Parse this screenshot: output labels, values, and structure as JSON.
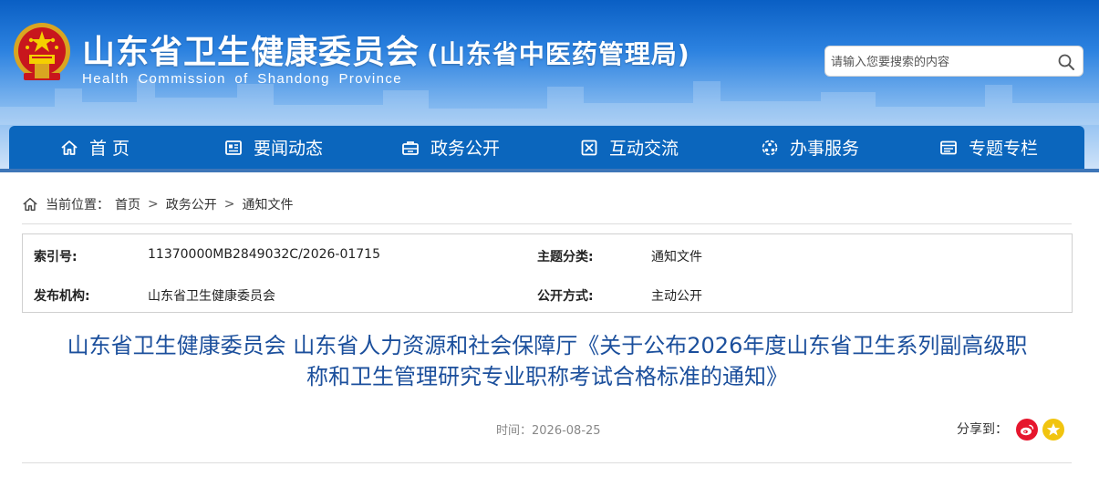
{
  "header": {
    "title": "山东省卫生健康委员会",
    "subtitle": "(山东省中医药管理局)",
    "english_name": "Health Commission of Shandong Province",
    "search_placeholder": "请输入您要搜索的内容"
  },
  "nav": {
    "items": [
      {
        "label": "首 页",
        "icon": "home-icon"
      },
      {
        "label": "要闻动态",
        "icon": "news-icon"
      },
      {
        "label": "政务公开",
        "icon": "briefcase-icon"
      },
      {
        "label": "互动交流",
        "icon": "interaction-icon"
      },
      {
        "label": "办事服务",
        "icon": "service-icon"
      },
      {
        "label": "专题专栏",
        "icon": "topic-icon"
      }
    ]
  },
  "breadcrumb": {
    "prefix": "当前位置：",
    "items": [
      "首页",
      "政务公开",
      "通知文件"
    ],
    "separator": ">"
  },
  "meta": {
    "index_label": "索引号:",
    "index_value": "11370000MB2849032C/2026-01715",
    "topic_label": "主题分类:",
    "topic_value": "通知文件",
    "publisher_label": "发布机构:",
    "publisher_value": "山东省卫生健康委员会",
    "disclosure_label": "公开方式:",
    "disclosure_value": "主动公开"
  },
  "article": {
    "title_line1": "山东省卫生健康委员会 山东省人力资源和社会保障厅《关于公布2026年度山东省卫生系列副高级职",
    "title_line2": "称和卫生管理研究专业职称考试合格标准的通知》",
    "time_label": "时间：",
    "time_value": "2026-08-25",
    "share_label": "分享到："
  },
  "colors": {
    "nav_bg": "#0b66bd",
    "title_blue": "#1b4f9c",
    "weibo_red": "#e6162d",
    "fav_yellow": "#f1c40f"
  }
}
